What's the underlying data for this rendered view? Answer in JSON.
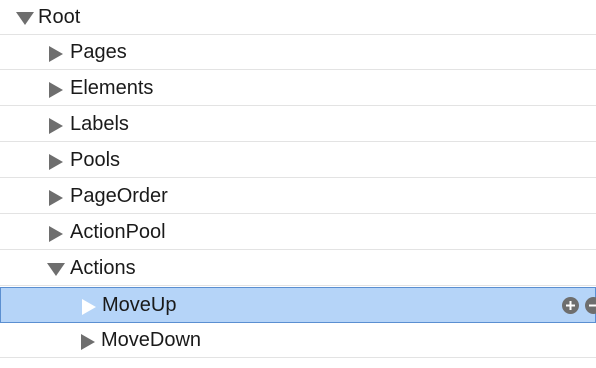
{
  "tree": {
    "root": {
      "label": "Root",
      "expanded": true
    },
    "items": [
      {
        "label": "Pages",
        "expanded": false
      },
      {
        "label": "Elements",
        "expanded": false
      },
      {
        "label": "Labels",
        "expanded": false
      },
      {
        "label": "Pools",
        "expanded": false
      },
      {
        "label": "PageOrder",
        "expanded": false
      },
      {
        "label": "ActionPool",
        "expanded": false
      },
      {
        "label": "Actions",
        "expanded": true
      }
    ],
    "actions_children": [
      {
        "label": "MoveUp",
        "expanded": false,
        "selected": true
      },
      {
        "label": "MoveDown",
        "expanded": false,
        "selected": false
      }
    ]
  },
  "colors": {
    "selection_fill": "#b5d4f8",
    "selection_border": "#5b8fd1",
    "row_divider": "#e3e3e3",
    "disclosure": "#6e6e6e"
  },
  "icons": {
    "collapsed": "triangle-right-icon",
    "expanded": "triangle-down-icon",
    "add": "plus-circle-icon"
  }
}
